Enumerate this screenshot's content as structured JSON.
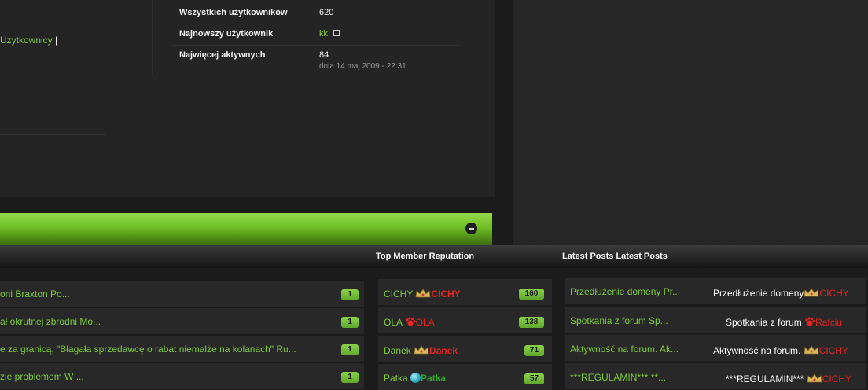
{
  "users_link": {
    "label": "Użytkownicy",
    "sep": "|"
  },
  "stats": [
    {
      "label": "Wszystkich użytkowników",
      "value": "620"
    },
    {
      "label": "Najnowszy użytkownik",
      "value": "kk."
    },
    {
      "label": "Najwięcej aktywnych",
      "value": "84",
      "date": "dnia 14 maj 2009 - 22:31"
    }
  ],
  "headers": {
    "reputation": "Top Member Reputation",
    "latest_posts": "Latest Posts Latest Posts"
  },
  "topics": [
    {
      "title": "oni Braxton Po...",
      "count": "1"
    },
    {
      "title": "ał okrutnej zbrodni Mo...",
      "count": "1"
    },
    {
      "title": "e za granicą, \"Błagała sprzedawcę o rabat niemalże na kolanach\" Ru...",
      "count": "1"
    },
    {
      "title": "zie problemem W ...",
      "count": "1"
    }
  ],
  "reputation": [
    {
      "name": "CICHY",
      "display": "CICHY",
      "icon": "crown-icon",
      "style": "red",
      "points": "160"
    },
    {
      "name": "OLA",
      "display": "OLA",
      "icon": "paw-icon",
      "style": "red",
      "points": "138"
    },
    {
      "name": "Danek",
      "display": "Danek",
      "icon": "crown-icon",
      "style": "red",
      "points": "71"
    },
    {
      "name": "Patka",
      "display": "Patka",
      "icon": "globe-icon",
      "style": "green",
      "points": "57"
    }
  ],
  "latest_posts": [
    {
      "title": "Przedłużenie domeny Pr...",
      "preview": "Przedłużenie domeny",
      "author": "CICHY",
      "icon": "crown-icon"
    },
    {
      "title": "Spotkania z forum Sp...",
      "preview": "Spotkania z forum",
      "author": "Rafciu",
      "icon": "paw-icon"
    },
    {
      "title": "Aktywność na forum. Ak...",
      "preview": "Aktywność na forum.",
      "author": "CICHY",
      "icon": "crown-icon"
    },
    {
      "title": "***REGULAMIN*** **...",
      "preview": "***REGULAMIN***",
      "author": "CICHY",
      "icon": "crown-icon"
    }
  ],
  "colors": {
    "accent_green": "#7cc93a",
    "author_red": "#e32222",
    "background": "#1b1b1b"
  }
}
